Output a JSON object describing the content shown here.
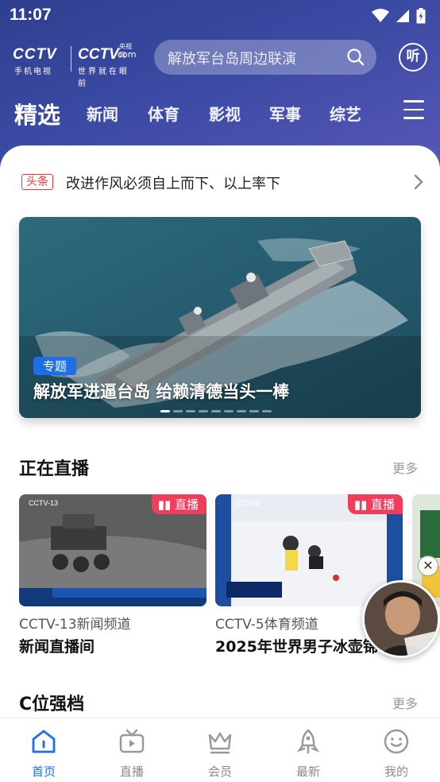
{
  "status_bar": {
    "time": "11:07"
  },
  "logo": {
    "left_brand": "CCTV",
    "left_sub": "手机电视",
    "right_brand": "CCTV",
    "right_com": "com",
    "right_tag": "央视网",
    "right_sub": "世界就在眼前"
  },
  "search": {
    "placeholder": "解放军台岛周边联演"
  },
  "listen_button": {
    "label": "听"
  },
  "tabs": [
    {
      "label": "精选",
      "active": true
    },
    {
      "label": "新闻"
    },
    {
      "label": "体育"
    },
    {
      "label": "影视"
    },
    {
      "label": "军事"
    },
    {
      "label": "综艺"
    }
  ],
  "headline": {
    "tag": "头条",
    "text": "改进作风必须自上而下、以上率下"
  },
  "banner": {
    "badge": "专题",
    "title": "解放军进逼台岛 给赖清德当头一棒",
    "slide_count": 9,
    "active_slide": 1
  },
  "live_section": {
    "title": "正在直播",
    "more": "更多",
    "items": [
      {
        "badge": "直播",
        "channel": "CCTV-13新闻频道",
        "program": "新闻直播间"
      },
      {
        "badge": "直播",
        "channel": "CCTV-5体育频道",
        "program": "2025年世界男子冰壶锦"
      }
    ]
  },
  "c_section": {
    "title": "C位强档",
    "more": "更多"
  },
  "bottom_nav": [
    {
      "label": "首页",
      "icon": "home-icon",
      "active": true
    },
    {
      "label": "直播",
      "icon": "tv-icon"
    },
    {
      "label": "会员",
      "icon": "crown-icon"
    },
    {
      "label": "最新",
      "icon": "rocket-icon"
    },
    {
      "label": "我的",
      "icon": "smiley-icon"
    }
  ],
  "colors": {
    "accent": "#1b6ff0",
    "live_badge": "#ef3d5b",
    "header_bg": "#3b4aa3"
  }
}
